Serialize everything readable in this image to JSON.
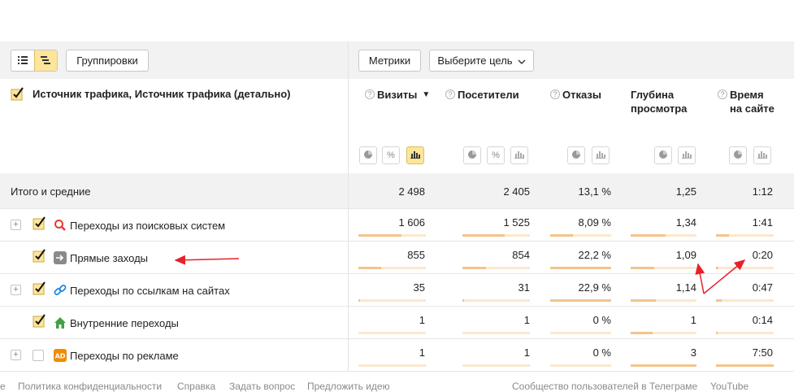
{
  "toolbar": {
    "groupings_label": "Группировки",
    "metrics_label": "Метрики",
    "goal_select": "Выберите цель",
    "view_list_icon": "list-icon",
    "view_tree_icon": "tree-icon"
  },
  "table": {
    "dimension_header": "Источник трафика, Источник трафика (детально)",
    "columns": [
      {
        "line1": "Визиты",
        "line2": "",
        "sort": "▼"
      },
      {
        "line1": "Посетители",
        "line2": ""
      },
      {
        "line1": "Отказы",
        "line2": ""
      },
      {
        "line1": "Глубина",
        "line2": "просмотра"
      },
      {
        "line1": "Время",
        "line2": "на сайте"
      }
    ],
    "viz_buttons": {
      "pie": "pie-chart-icon",
      "percent": "%",
      "bars": "bar-chart-icon"
    },
    "totals": {
      "label": "Итого и средние",
      "values": [
        "2 498",
        "2 405",
        "13,1 %",
        "1,25",
        "1:12"
      ]
    },
    "rows": [
      {
        "label": "Переходы из поисковых систем",
        "icon": "search-icon",
        "expandable": true,
        "checked": true,
        "values": [
          "1 606",
          "1 525",
          "8,09 %",
          "1,34",
          "1:41"
        ],
        "bars": [
          0.64,
          0.63,
          0.37,
          0.53,
          0.22
        ]
      },
      {
        "label": "Прямые заходы",
        "icon": "direct-arrow-icon",
        "expandable": false,
        "checked": true,
        "values": [
          "855",
          "854",
          "22,2 %",
          "1,09",
          "0:20"
        ],
        "bars": [
          0.34,
          0.35,
          1.0,
          0.36,
          0.04
        ]
      },
      {
        "label": "Переходы по ссылкам на сайтах",
        "icon": "link-icon",
        "expandable": true,
        "checked": true,
        "values": [
          "35",
          "31",
          "22,9 %",
          "1,14",
          "0:47"
        ],
        "bars": [
          0.02,
          0.02,
          1.0,
          0.38,
          0.1
        ]
      },
      {
        "label": "Внутренние переходы",
        "icon": "home-icon",
        "expandable": false,
        "checked": true,
        "values": [
          "1",
          "1",
          "0 %",
          "1",
          "0:14"
        ],
        "bars": [
          0.0,
          0.0,
          0.0,
          0.33,
          0.03
        ]
      },
      {
        "label": "Переходы по рекламе",
        "icon": "ad-icon",
        "expandable": true,
        "checked": false,
        "values": [
          "1",
          "1",
          "0 %",
          "3",
          "7:50"
        ],
        "bars": [
          0.0,
          0.0,
          0.0,
          1.0,
          1.0
        ]
      }
    ]
  },
  "footer": {
    "partial": "е",
    "privacy": "Политика конфиденциальности",
    "help": "Справка",
    "ask": "Задать вопрос",
    "suggest": "Предложить идею",
    "community": "Сообщество пользователей в Телеграме",
    "youtube": "YouTube"
  },
  "colors": {
    "accent": "#fde59a",
    "bar_fill": "#f4c38a",
    "bar_track": "#fbe8cf",
    "annotation_arrow": "#e8202a"
  }
}
